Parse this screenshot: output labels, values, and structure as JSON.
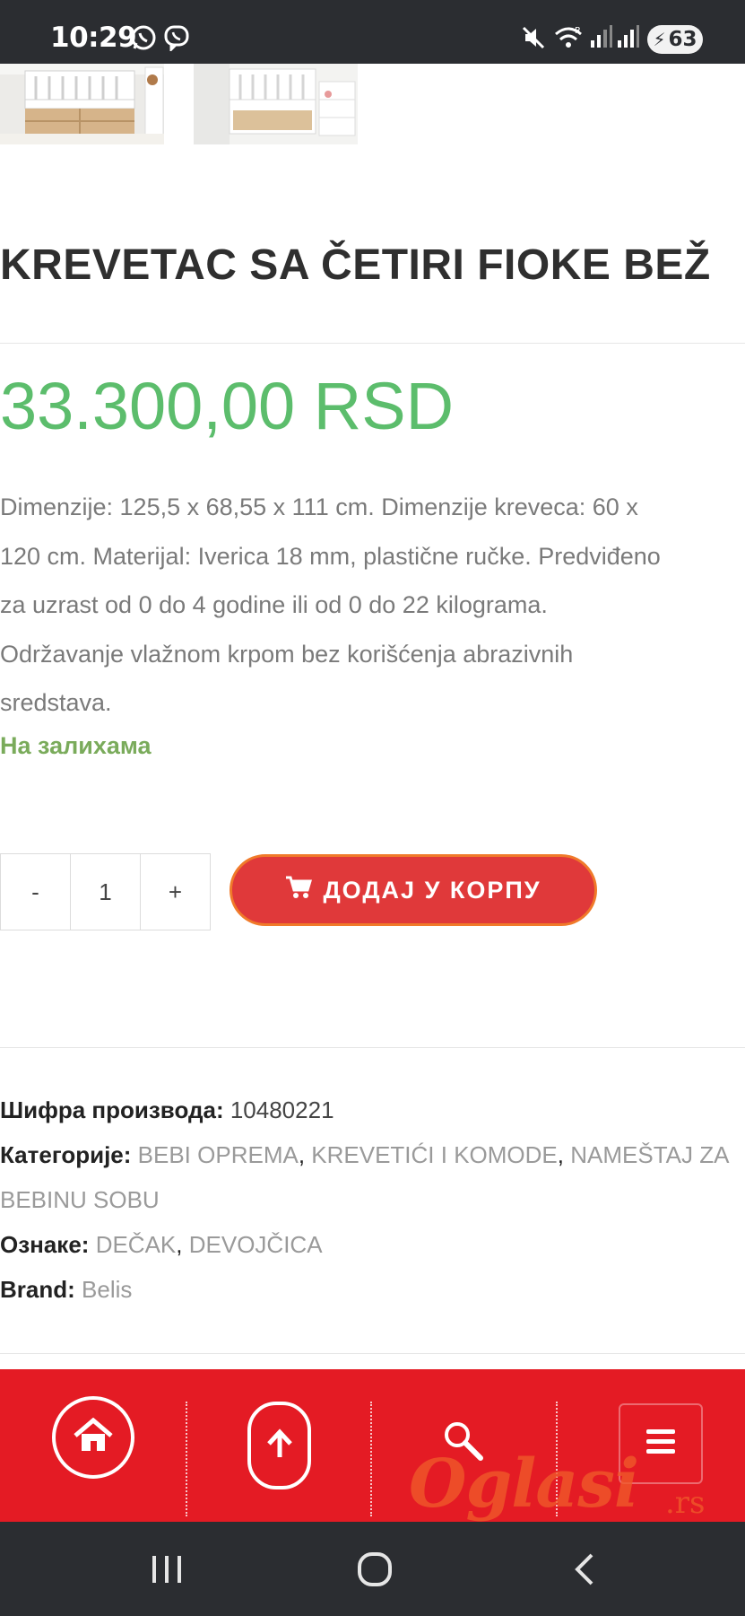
{
  "status_bar": {
    "time": "10:29",
    "app_icons": [
      "whatsapp-icon",
      "viber-icon"
    ],
    "right_icons": [
      "mute-icon",
      "wifi-icon",
      "signal-icon",
      "signal-icon"
    ],
    "battery": "63"
  },
  "product": {
    "title": "KREVETAC SA ČETIRI FIOKE BEŽ",
    "price": "33.300,00 RSD",
    "description_lines": [
      "Dimenzije: 125,5 x 68,55 x 111 cm. Dimenzije kreveca: 60 x",
      "120 cm. Materijal: Iverica 18 mm, plastične ručke. Predviđeno",
      "za uzrast od 0 do 4 godine ili od 0 do 22 kilograma.",
      "Održavanje vlažnom krpom bez korišćenja abrazivnih",
      "sredstava."
    ],
    "stock_status": "На залихама"
  },
  "cart": {
    "minus_label": "-",
    "quantity": "1",
    "plus_label": "+",
    "add_to_cart_label": "ДОДАЈ У КОРПУ"
  },
  "meta": {
    "sku_label": "Шифра производа:",
    "sku_value": "10480221",
    "categories_label": "Категорије:",
    "categories": [
      "BEBI OPREMA",
      "KREVETIĆI I KOMODE",
      "NAMEŠTAJ ZA",
      "BEBINU SOBU"
    ],
    "tags_label": "Ознаке:",
    "tags": [
      "DEČAK",
      "DEVOJČICA"
    ],
    "brand_label": "Brand:",
    "brand_value": "Belis"
  },
  "bottom_nav": {
    "items": [
      "home-icon",
      "arrow-up-icon",
      "search-icon",
      "menu-icon"
    ],
    "accent_color": "#e41b24"
  },
  "watermark": {
    "text": "Oglasi",
    "suffix": ".rs"
  },
  "colors": {
    "price": "#5cbd6c",
    "stock": "#7aab5b",
    "button": "#e0393a"
  }
}
